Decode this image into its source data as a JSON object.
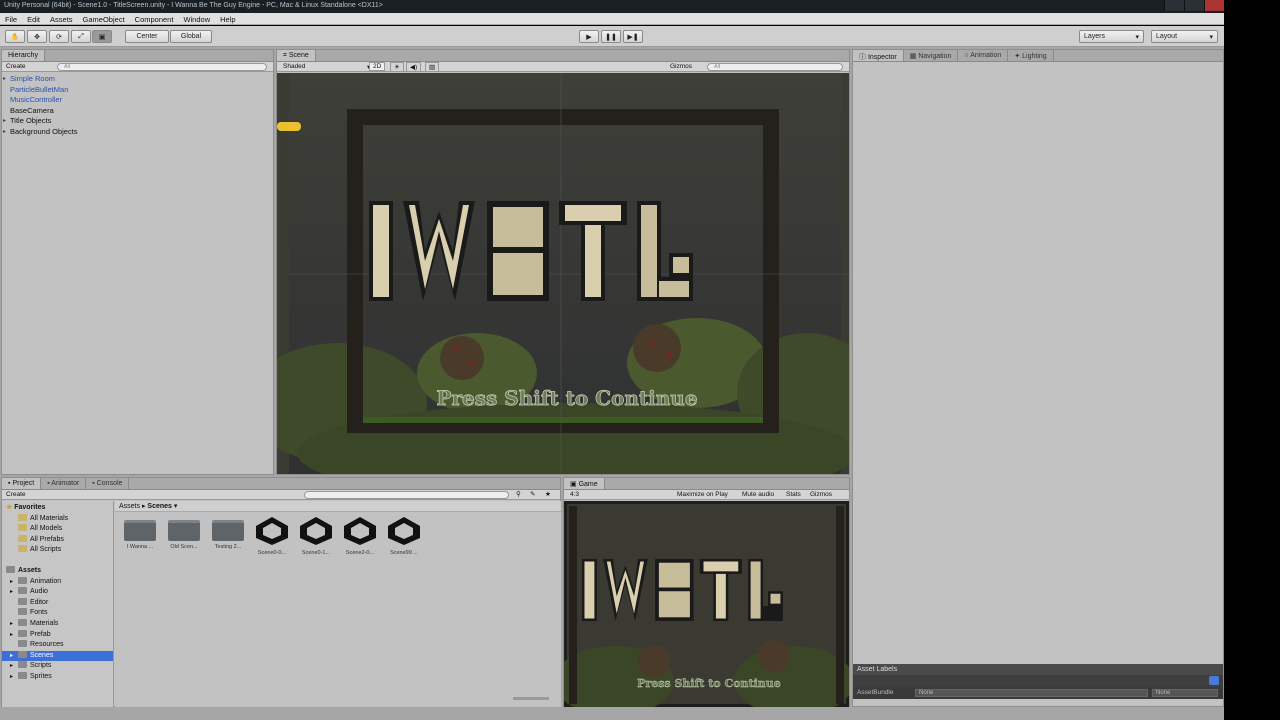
{
  "window": {
    "title": "Unity Personal (64bit) - Scene1.0 - TitleScreen.unity - I Wanna Be The Guy Engine - PC, Mac & Linux Standalone <DX11>"
  },
  "menubar": [
    "File",
    "Edit",
    "Assets",
    "GameObject",
    "Component",
    "Window",
    "Help"
  ],
  "toolbar": {
    "pivot_label": "Center",
    "space_label": "Global",
    "layers_label": "Layers",
    "layout_label": "Layout"
  },
  "hierarchy": {
    "tab": "Hierarchy",
    "create_label": "Create",
    "search_placeholder": "All",
    "items": [
      {
        "label": "Simple Room",
        "blue": true,
        "arrow": true
      },
      {
        "label": "ParticleBulletMan",
        "blue": true,
        "arrow": false
      },
      {
        "label": "MusicController",
        "blue": true,
        "arrow": false
      },
      {
        "label": "BaseCamera",
        "blue": false,
        "arrow": false
      },
      {
        "label": "Title Objects",
        "blue": false,
        "arrow": true
      },
      {
        "label": "Background Objects",
        "blue": false,
        "arrow": true
      }
    ]
  },
  "scene": {
    "tab": "Scene",
    "shading": "Shaded",
    "mode_2d": "2D",
    "gizmos": "Gizmos",
    "search_placeholder": "All",
    "game_title_art": "IWBTG",
    "press_text": "Press Shift to Continue"
  },
  "inspector": {
    "tabs": [
      "Inspector",
      "Navigation",
      "Animation",
      "Lighting"
    ],
    "asset_labels": "Asset Labels",
    "assetbundle_label": "AssetBundle",
    "assetbundle_value": "None",
    "assetbundle_variant": "None"
  },
  "project": {
    "tabs": [
      "Project",
      "Animator",
      "Console"
    ],
    "create_label": "Create",
    "breadcrumb": [
      "Assets",
      "Scenes"
    ],
    "favorites_label": "Favorites",
    "favorites": [
      "All Materials",
      "All Models",
      "All Prefabs",
      "All Scripts"
    ],
    "assets_label": "Assets",
    "folders": [
      {
        "label": "Animation",
        "arrow": true,
        "selected": false
      },
      {
        "label": "Audio",
        "arrow": true,
        "selected": false
      },
      {
        "label": "Editor",
        "arrow": false,
        "selected": false
      },
      {
        "label": "Fonts",
        "arrow": false,
        "selected": false
      },
      {
        "label": "Materials",
        "arrow": true,
        "selected": false
      },
      {
        "label": "Prefab",
        "arrow": true,
        "selected": false
      },
      {
        "label": "Resources",
        "arrow": false,
        "selected": false
      },
      {
        "label": "Scenes",
        "arrow": true,
        "selected": true
      },
      {
        "label": "Scripts",
        "arrow": true,
        "selected": false
      },
      {
        "label": "Sprites",
        "arrow": true,
        "selected": false
      }
    ],
    "grid_items": [
      {
        "label": "I Wanna ...",
        "kind": "folder"
      },
      {
        "label": "Old Scen...",
        "kind": "folder"
      },
      {
        "label": "Testing 2...",
        "kind": "folder"
      },
      {
        "label": "Scene0-0...",
        "kind": "unity"
      },
      {
        "label": "Scene0-1...",
        "kind": "unity"
      },
      {
        "label": "Scene2-0...",
        "kind": "unity"
      },
      {
        "label": "Scene99 ...",
        "kind": "unity"
      }
    ]
  },
  "game": {
    "tab": "Game",
    "aspect": "4:3",
    "maximize": "Maximize on Play",
    "mute": "Mute audio",
    "stats": "Stats",
    "gizmos": "Gizmos"
  },
  "colors": {
    "selection": "#3d6fd6",
    "hierarchy_prefab": "#2a4fb0",
    "scene_bg": "#3a3a33"
  }
}
